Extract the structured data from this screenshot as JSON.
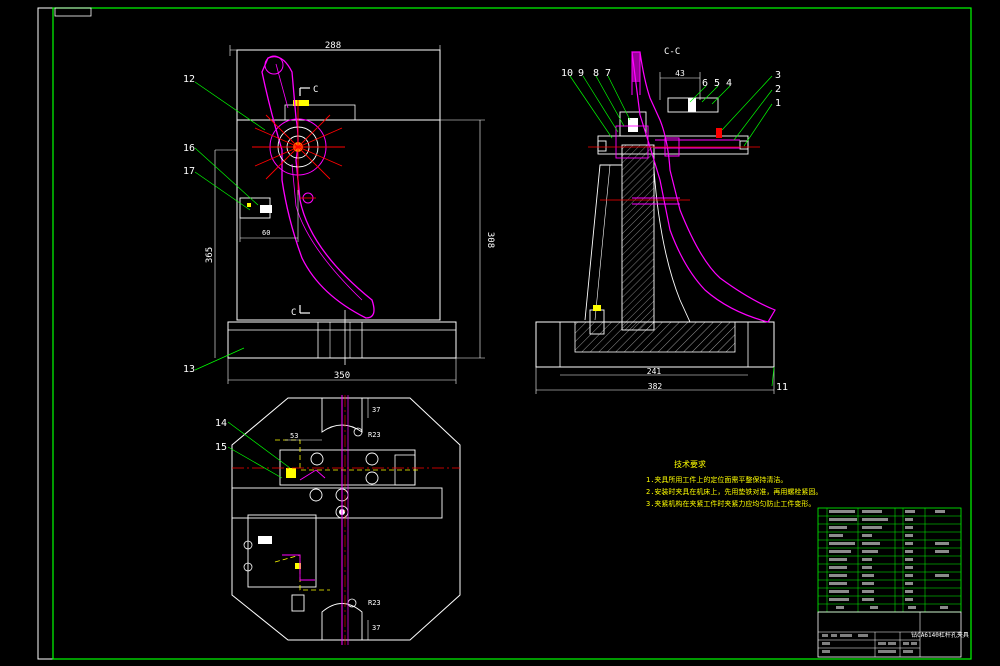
{
  "section_label": "C-C",
  "section_marks": [
    "C",
    "C"
  ],
  "front_view": {
    "dims": {
      "top_width": "288",
      "height_right": "308",
      "height_left": "365",
      "bottom_width": "350",
      "slot": "60"
    },
    "callouts": [
      "12",
      "16",
      "17",
      "13"
    ]
  },
  "side_view": {
    "dims": {
      "top": "43",
      "base_inner": "241",
      "base_total": "382"
    },
    "callouts_left": [
      "10",
      "9",
      "8",
      "7"
    ],
    "callouts_top": [
      "6",
      "5",
      "4"
    ],
    "callouts_right": [
      "3",
      "2",
      "1"
    ],
    "callout_bottom_right": "11"
  },
  "plan_view": {
    "dims": {
      "top": "37",
      "r_top": "R23",
      "width": "53",
      "r_bottom": "R23",
      "bottom": "37"
    },
    "callouts": [
      "14",
      "15"
    ]
  },
  "notes": {
    "title": "技术要求",
    "items": [
      "1.夹具所用工件上的定位面需平整保持清洁。",
      "2.安装时夹具在机床上，先用垫铁对准，再用螺栓紧固。",
      "3.夹紧机构在夹紧工件时夹紧力应均匀防止工件变形。"
    ]
  },
  "title_block": {
    "drawing_title": "钻CA6140杠杆孔夹具",
    "rows": [
      "",
      "",
      "",
      "",
      "",
      "",
      "",
      "",
      "",
      "",
      "",
      ""
    ]
  }
}
